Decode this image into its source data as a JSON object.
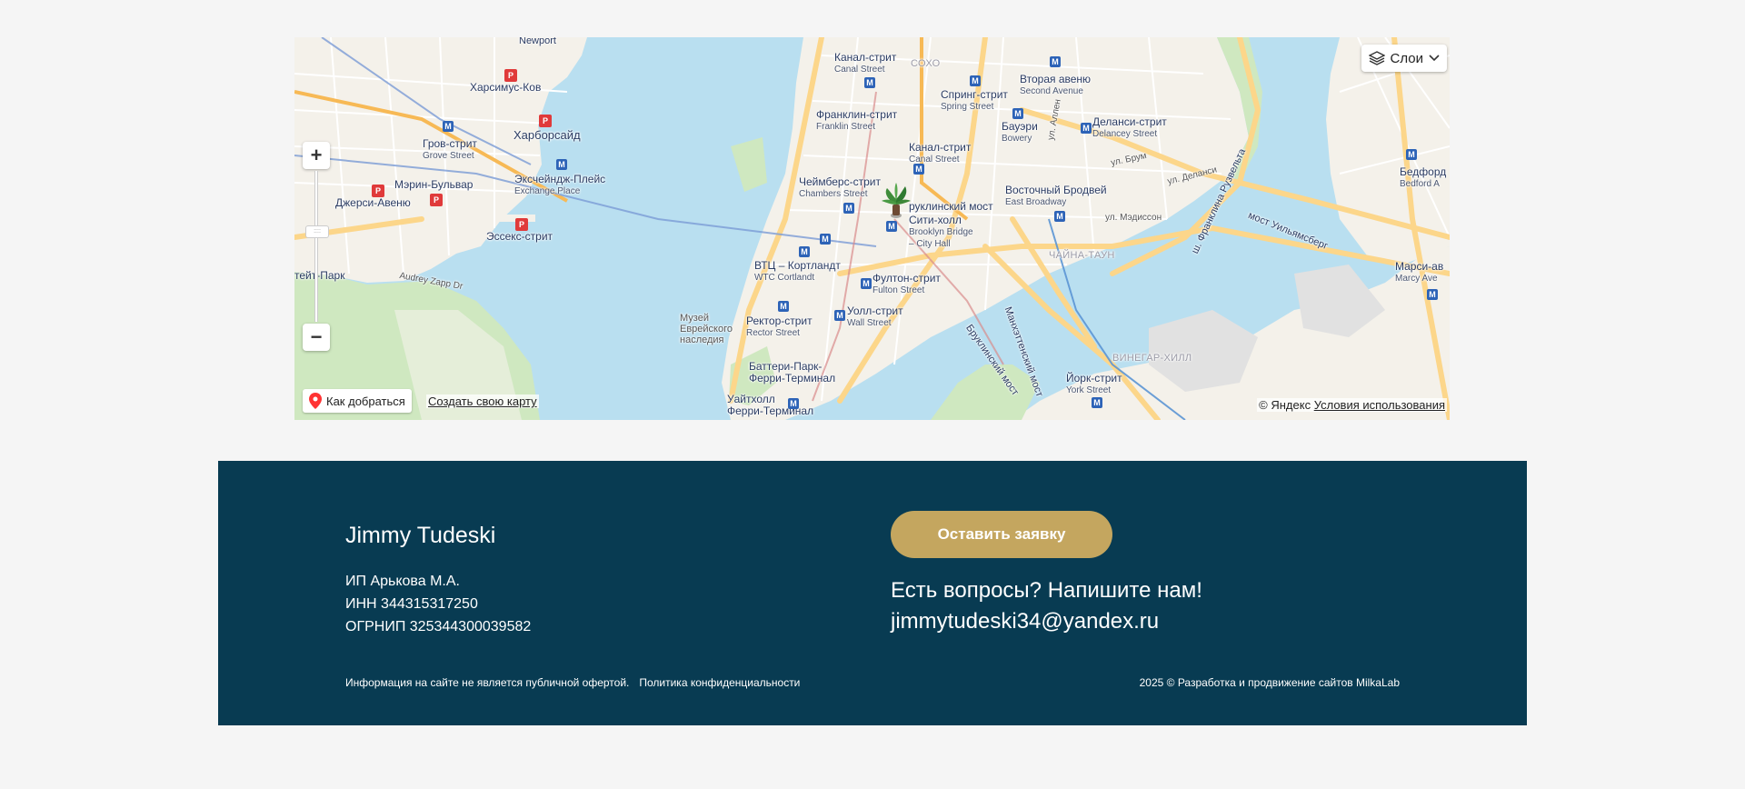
{
  "map": {
    "labels": {
      "newport": "Newport",
      "harsimus": "Харсимус-Ков",
      "harborside": "Харборсайд",
      "grove_ru": "Гров-стрит",
      "grove_en": "Grove Street",
      "exchange_ru": "Эксчейндж-Плейс",
      "exchange_en": "Exchange Place",
      "marin": "Мэрин-Бульвар",
      "jersey_ave": "Джерси-Авеню",
      "essex": "Эссекс-стрит",
      "liberty": "тейт-Парк",
      "audrey": "Audrey Zapp Dr",
      "canal1_ru": "Канал-стрит",
      "canal1_en": "Canal Street",
      "soho": "СОХО",
      "spring_ru": "Спринг-стрит",
      "spring_en": "Spring Street",
      "second_ru": "Вторая авеню",
      "second_en": "Second Avenue",
      "franklin_ru": "Франклин-стрит",
      "franklin_en": "Franklin Street",
      "bowery_ru": "Бауэри",
      "bowery_en": "Bowery",
      "delancey_ru": "Деланси-стрит",
      "delancey_en": "Delancey Street",
      "canal2_ru": "Канал-стрит",
      "canal2_en": "Canal Street",
      "chambers_ru": "Чеймберс-стрит",
      "chambers_en": "Chambers Street",
      "brooklyn_bridge": "руклинский мост",
      "east_broadway_ru": "Восточный Бродвей",
      "east_broadway_en": "East Broadway",
      "city_hall_ru": "Сити-холл",
      "city_hall_en1": "Brooklyn Bridge",
      "city_hall_en2": "– City Hall",
      "madison": "ул. Мэдиссон",
      "chinatown": "ЧАЙНА-ТАУН",
      "wtc_ru": "ВТЦ – Кортландт",
      "wtc_en": "WTC Cortlandt",
      "fulton_ru": "Фултон-стрит",
      "fulton_en": "Fulton Street",
      "museum1": "Музей",
      "museum2": "Еврейского",
      "museum3": "наследия",
      "rector_ru": "Ректор-стрит",
      "rector_en": "Rector Street",
      "wall_ru": "Уолл-стрит",
      "wall_en": "Wall Street",
      "battery1": "Баттери-Парк-",
      "battery2": "Ферри-Терминал",
      "whitehall1": "Уайтхолл",
      "whitehall2": "Ферри-Терминал",
      "york_ru": "Йорк-стрит",
      "york_en": "York Street",
      "vinegar": "ВИНЕГАР-ХИЛЛ",
      "manhattan_bridge": "Манхэттенский мост",
      "brooklyn_bridge2": "Бруклинский мост",
      "williamsburg": "мост Уильямсберг",
      "roosevelt": "ш. Франклина Рузвельта",
      "bedford_ru": "Бедфорд",
      "bedford_en": "Bedford A",
      "marcy_ru": "Марси-ав",
      "marcy_en": "Marcy Ave",
      "allen": "ул. Аллен",
      "broome": "ул. Брум",
      "delancey_st": "ул. Деланси"
    },
    "layers_label": "Слои",
    "route_label": "Как добраться",
    "create_map_label": "Создать свою карту",
    "copyright_prefix": "© Яндекс",
    "terms_label": "Условия использования",
    "zoom_in": "+",
    "zoom_out": "−"
  },
  "footer": {
    "brand": "Jimmy Tudeski",
    "legal_lines": [
      "ИП Арькова М.А.",
      "ИНН 344315317250",
      "ОГРНИП 325344300039582"
    ],
    "cta_label": "Оставить заявку",
    "questions": "Есть вопросы? Напишите нам!",
    "email": "jimmytudeski34@yandex.ru",
    "disclaimer": "Информация на сайте не является публичной офертой.",
    "privacy": "Политика конфиденциальности",
    "credits": "2025 © Разработка и продвижение сайтов MilkaLab"
  },
  "colors": {
    "footer_bg": "#083b52",
    "cta_bg": "#c4a65f",
    "water": "#b9dff0",
    "land": "#f4f1ea",
    "park": "#cfe8c0",
    "major_road": "#fcd68a"
  }
}
